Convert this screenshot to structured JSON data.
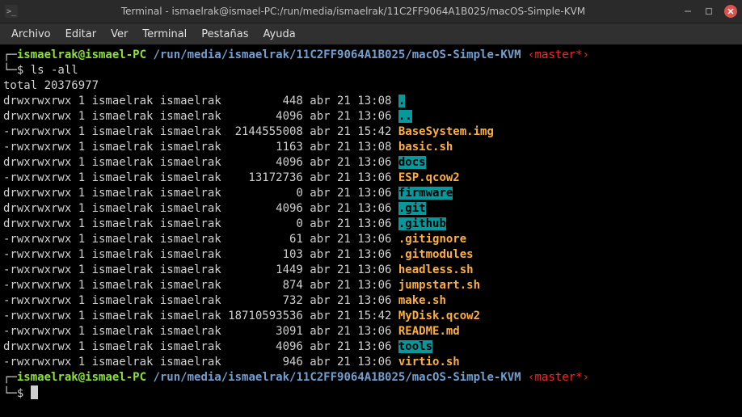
{
  "titlebar": {
    "icon_glyph": ">_",
    "title": "Terminal - ismaelrak@ismael-PC:/run/media/ismaelrak/11C2FF9064A1B025/macOS-Simple-KVM"
  },
  "menus": [
    "Archivo",
    "Editar",
    "Ver",
    "Terminal",
    "Pestañas",
    "Ayuda"
  ],
  "prompt": {
    "user_host": "ismaelrak@ismael-PC",
    "path": "/run/media/ismaelrak/11C2FF9064A1B025/macOS-Simple-KVM",
    "branch": "‹master*›",
    "symbol": "$",
    "top_corner": "┌─",
    "bot_corner": "└─"
  },
  "command": "ls -all",
  "total_line": "total 20376977",
  "entries": [
    {
      "perm": "drwxrwxrwx",
      "links": "1",
      "user": "ismaelrak",
      "group": "ismaelrak",
      "size": "448",
      "date": "abr 21 13:08",
      "name": ".",
      "class": "c-cyan-bg"
    },
    {
      "perm": "drwxrwxrwx",
      "links": "1",
      "user": "ismaelrak",
      "group": "ismaelrak",
      "size": "4096",
      "date": "abr 21 13:06",
      "name": "..",
      "class": "c-cyan-bg"
    },
    {
      "perm": "-rwxrwxrwx",
      "links": "1",
      "user": "ismaelrak",
      "group": "ismaelrak",
      "size": "2144555008",
      "date": "abr 21 15:42",
      "name": "BaseSystem.img",
      "class": "c-orange"
    },
    {
      "perm": "-rwxrwxrwx",
      "links": "1",
      "user": "ismaelrak",
      "group": "ismaelrak",
      "size": "1163",
      "date": "abr 21 13:08",
      "name": "basic.sh",
      "class": "c-orange"
    },
    {
      "perm": "drwxrwxrwx",
      "links": "1",
      "user": "ismaelrak",
      "group": "ismaelrak",
      "size": "4096",
      "date": "abr 21 13:06",
      "name": "docs",
      "class": "c-cyan-bg"
    },
    {
      "perm": "-rwxrwxrwx",
      "links": "1",
      "user": "ismaelrak",
      "group": "ismaelrak",
      "size": "13172736",
      "date": "abr 21 13:06",
      "name": "ESP.qcow2",
      "class": "c-orange"
    },
    {
      "perm": "drwxrwxrwx",
      "links": "1",
      "user": "ismaelrak",
      "group": "ismaelrak",
      "size": "0",
      "date": "abr 21 13:06",
      "name": "firmware",
      "class": "c-cyan-bg"
    },
    {
      "perm": "drwxrwxrwx",
      "links": "1",
      "user": "ismaelrak",
      "group": "ismaelrak",
      "size": "4096",
      "date": "abr 21 13:06",
      "name": ".git",
      "class": "c-cyan-bg"
    },
    {
      "perm": "drwxrwxrwx",
      "links": "1",
      "user": "ismaelrak",
      "group": "ismaelrak",
      "size": "0",
      "date": "abr 21 13:06",
      "name": ".github",
      "class": "c-cyan-bg"
    },
    {
      "perm": "-rwxrwxrwx",
      "links": "1",
      "user": "ismaelrak",
      "group": "ismaelrak",
      "size": "61",
      "date": "abr 21 13:06",
      "name": ".gitignore",
      "class": "c-orange"
    },
    {
      "perm": "-rwxrwxrwx",
      "links": "1",
      "user": "ismaelrak",
      "group": "ismaelrak",
      "size": "103",
      "date": "abr 21 13:06",
      "name": ".gitmodules",
      "class": "c-orange"
    },
    {
      "perm": "-rwxrwxrwx",
      "links": "1",
      "user": "ismaelrak",
      "group": "ismaelrak",
      "size": "1449",
      "date": "abr 21 13:06",
      "name": "headless.sh",
      "class": "c-orange"
    },
    {
      "perm": "-rwxrwxrwx",
      "links": "1",
      "user": "ismaelrak",
      "group": "ismaelrak",
      "size": "874",
      "date": "abr 21 13:06",
      "name": "jumpstart.sh",
      "class": "c-orange"
    },
    {
      "perm": "-rwxrwxrwx",
      "links": "1",
      "user": "ismaelrak",
      "group": "ismaelrak",
      "size": "732",
      "date": "abr 21 13:06",
      "name": "make.sh",
      "class": "c-orange"
    },
    {
      "perm": "-rwxrwxrwx",
      "links": "1",
      "user": "ismaelrak",
      "group": "ismaelrak",
      "size": "18710593536",
      "date": "abr 21 15:42",
      "name": "MyDisk.qcow2",
      "class": "c-orange"
    },
    {
      "perm": "-rwxrwxrwx",
      "links": "1",
      "user": "ismaelrak",
      "group": "ismaelrak",
      "size": "3091",
      "date": "abr 21 13:06",
      "name": "README.md",
      "class": "c-orange"
    },
    {
      "perm": "drwxrwxrwx",
      "links": "1",
      "user": "ismaelrak",
      "group": "ismaelrak",
      "size": "4096",
      "date": "abr 21 13:06",
      "name": "tools",
      "class": "c-cyan-bg"
    },
    {
      "perm": "-rwxrwxrwx",
      "links": "1",
      "user": "ismaelrak",
      "group": "ismaelrak",
      "size": "946",
      "date": "abr 21 13:06",
      "name": "virtio.sh",
      "class": "c-orange"
    }
  ]
}
